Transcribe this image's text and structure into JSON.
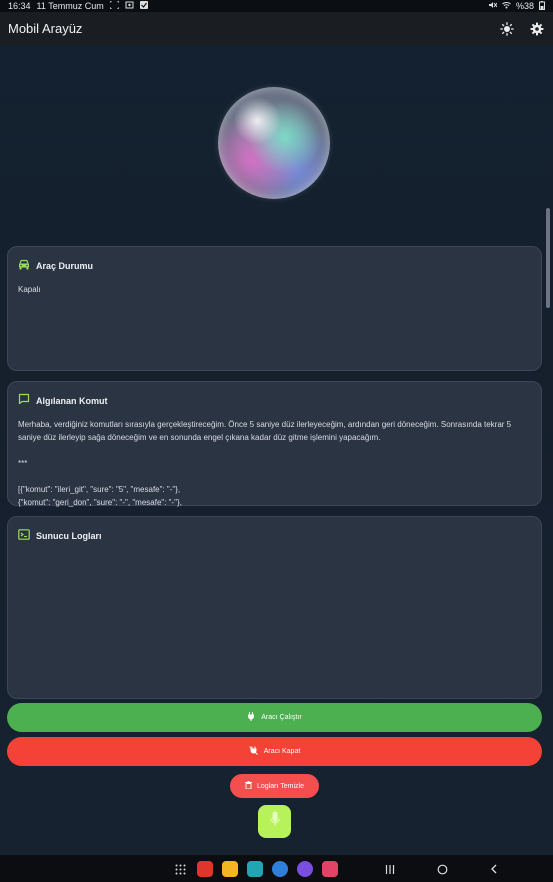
{
  "status_bar": {
    "time": "16:34",
    "date": "11 Temmuz Cum",
    "battery": "%38"
  },
  "app_bar": {
    "title": "Mobil Arayüz",
    "actions": [
      "brightness-icon",
      "settings-icon"
    ]
  },
  "cards": {
    "vehicle_status": {
      "title": "Araç Durumu",
      "icon": "car-icon",
      "body": "Kapalı"
    },
    "detected_command": {
      "title": "Algılanan Komut",
      "icon": "chat-icon",
      "body": "Merhaba, verdiğiniz komutları sırasıyla gerçekleştireceğim. Önce 5 saniye düz ilerleyeceğim, ardından geri döneceğim. Sonrasında tekrar 5 saniye düz ilerleyip sağa döneceğim ve en sonunda engel çıkana kadar düz gitme işlemini yapacağım.\n\n***\n\n[{\"komut\": \"ileri_git\", \"sure\": \"5\", \"mesafe\": \"-\"},\n{\"komut\": \"geri_don\", \"sure\": \"-\", \"mesafe\": \"-\"},"
    },
    "server_logs": {
      "title": "Sunucu Logları",
      "icon": "terminal-icon",
      "body": ""
    }
  },
  "buttons": {
    "run": "Aracı Çalıştır",
    "stop": "Aracı Kapat",
    "clear_logs": "Logları Temizle"
  },
  "colors": {
    "accent": "#b8f25a",
    "run": "#4caf50",
    "stop": "#f44336",
    "card": "#2b3442",
    "background": "#16202c"
  },
  "nav_bar": {
    "apps": [
      "apps-grid-icon",
      "flipboard-icon",
      "notes-icon",
      "calendar-icon",
      "messages-icon",
      "internet-icon",
      "screen-recorder-icon"
    ]
  }
}
